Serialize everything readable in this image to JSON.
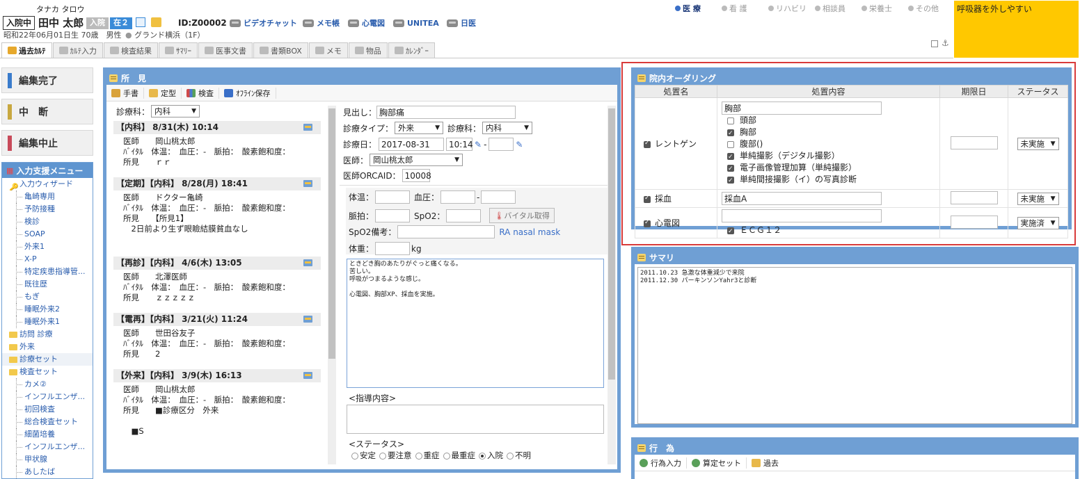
{
  "header": {
    "kana": "タナカ タロウ",
    "admit_label": "入院中",
    "name": "田中 太郎",
    "status_a": "入院",
    "status_b": "在２",
    "patient_id": "ID:Z00002",
    "birth": "昭和22年06月01日生 70歳　男性",
    "ward": "グランド横浜（1F）",
    "tools": [
      "ビデオチャット",
      "メモ帳",
      "心電図",
      "UNITEA",
      "日医"
    ],
    "roles": [
      "医 療",
      "看 護",
      "リハビリ",
      "相談員",
      "栄養士",
      "その他"
    ],
    "alert": "呼吸器を外しやすい",
    "tabs": [
      "過去ｶﾙﾃ",
      "ｶﾙﾃ入力",
      "検査結果",
      "ｻﾏﾘｰ",
      "医事文書",
      "書類BOX",
      "メモ",
      "物品",
      "ｶﾚﾝﾀﾞｰ"
    ]
  },
  "left_buttons": [
    "編集完了",
    "中　断",
    "編集中止"
  ],
  "menu": {
    "title": "入力支援メニュー",
    "items": [
      {
        "label": "入力ウィザード",
        "level": 1,
        "icon": "key"
      },
      {
        "label": "亀崎専用",
        "level": 2
      },
      {
        "label": "予防接種",
        "level": 2
      },
      {
        "label": "検診",
        "level": 2
      },
      {
        "label": "SOAP",
        "level": 2
      },
      {
        "label": "外来1",
        "level": 2
      },
      {
        "label": "X-P",
        "level": 2
      },
      {
        "label": "特定疾患指導管...",
        "level": 2
      },
      {
        "label": "既往歴",
        "level": 2
      },
      {
        "label": "もぎ",
        "level": 2
      },
      {
        "label": "睡眠外来2",
        "level": 2
      },
      {
        "label": "睡眠外来1",
        "level": 2
      },
      {
        "label": "訪問 診療",
        "level": 1,
        "icon": "folder"
      },
      {
        "label": "外来",
        "level": 1,
        "icon": "folder"
      },
      {
        "label": "診療セット",
        "level": 1,
        "icon": "folder",
        "selected": true
      },
      {
        "label": "検査セット",
        "level": 1,
        "icon": "folder"
      },
      {
        "label": "カメ②",
        "level": 2
      },
      {
        "label": "インフルエンザ...",
        "level": 2
      },
      {
        "label": "初回検査",
        "level": 2
      },
      {
        "label": "総合検査セット",
        "level": 2
      },
      {
        "label": "細菌培養",
        "level": 2
      },
      {
        "label": "インフルエンザ...",
        "level": 2
      },
      {
        "label": "甲状腺",
        "level": 2
      },
      {
        "label": "あしたば",
        "level": 2
      }
    ]
  },
  "shoken": {
    "title": "所　見",
    "toolbar": [
      "手書",
      "定型",
      "検査",
      "ｵﾌﾗｲﾝ保存"
    ],
    "dept_label": "診療科：",
    "dept_value": "内科",
    "entries": [
      {
        "head": "【内科】 8/31(木) 10:14",
        "lines": [
          "医師　　岡山桃太郎",
          "ﾊﾞｲﾀﾙ　体温：　血圧：-　脈拍：　酸素飽和度：",
          "所見　　ｒｒ"
        ]
      },
      {
        "head": "【定期】【内科】 8/28(月) 18:41",
        "lines": [
          "医師　　ドクター亀崎",
          "ﾊﾞｲﾀﾙ　体温：　血圧：-　脈拍：　酸素飽和度：",
          "所見　　【所見1】",
          "　2日前より生ず眼瞼結膜貧血なし"
        ]
      },
      {
        "head": "【再診】【内科】 4/6(木) 13:05",
        "lines": [
          "医師　　北澤医師",
          "ﾊﾞｲﾀﾙ　体温：　血圧：-　脈拍：　酸素飽和度：",
          "所見　　ｚｚｚｚｚ"
        ]
      },
      {
        "head": "【電再】【内科】 3/21(火) 11:24",
        "lines": [
          "医師　　世田谷友子",
          "ﾊﾞｲﾀﾙ　体温：　血圧：-　脈拍：　酸素飽和度：",
          "所見　　2"
        ]
      },
      {
        "head": "【外来】【内科】 3/9(木) 16:13",
        "lines": [
          "医師　　岡山桃太郎",
          "ﾊﾞｲﾀﾙ　体温：　血圧：-　脈拍：　酸素飽和度：",
          "所見　　■診療区分　外来",
          "",
          "　■S"
        ]
      }
    ],
    "form": {
      "midashi_label": "見出し：",
      "midashi": "胸部痛",
      "type_label": "診療タイプ：",
      "type": "外来",
      "dept_label": "診療科：",
      "dept": "内科",
      "date_label": "診療日：",
      "date": "2017-08-31",
      "time": "10:14",
      "doctor_label": "医師：",
      "doctor": "岡山桃太郎",
      "orca_label": "医師ORCAID：",
      "orca": "10008",
      "temp_label": "体温：",
      "bp_label": "血圧：",
      "pulse_label": "脈拍：",
      "spo2_label": "SpO2：",
      "vital_btn": "バイタル取得",
      "spo2note_label": "SpO2備考：",
      "spo2note_hint": "RA nasal mask",
      "weight_label": "体重：",
      "weight_unit": "kg",
      "note": "ときどき胸のあたりがぐっと痛くなる。\n苦しい。\n呼吸がつまるような感じ。\n\n心電図、胸部XP、採血を実施。",
      "guide_label": "<指導内容>",
      "status_label": "<ステータス>",
      "statuses": [
        "安定",
        "要注意",
        "重症",
        "最重症",
        "入院",
        "不明"
      ],
      "status_selected": 4
    }
  },
  "order": {
    "title": "院内オーダリング",
    "columns": [
      "処置名",
      "処置内容",
      "期限日",
      "ステータス"
    ],
    "rows": [
      {
        "name": "レントゲン",
        "checked": true,
        "text": "胸部",
        "sub": [
          {
            "label": "頭部",
            "checked": false
          },
          {
            "label": "胸部",
            "checked": true
          },
          {
            "label": "腹部()",
            "checked": false
          },
          {
            "label": "単純撮影（デジタル撮影）",
            "checked": true
          },
          {
            "label": "電子画像管理加算（単純撮影）",
            "checked": true
          },
          {
            "label": "単純間接撮影（イ）の写真診断",
            "checked": true
          }
        ],
        "status": "未実施"
      },
      {
        "name": "採血",
        "checked": true,
        "text": "採血A",
        "sub": [],
        "status": "未実施"
      },
      {
        "name": "心電図",
        "checked": true,
        "text": "",
        "sub": [
          {
            "label": "ＥＣＧ１２",
            "checked": true
          }
        ],
        "status": "実施済"
      }
    ]
  },
  "summary": {
    "title": "サマリ",
    "lines": [
      "2011.10.23 急激な体重減少で来院",
      "2011.12.30 パーキンソンYahr3と診断"
    ]
  },
  "koui": {
    "title": "行　為",
    "toolbar": [
      "行為入力",
      "算定セット",
      "過去"
    ]
  }
}
